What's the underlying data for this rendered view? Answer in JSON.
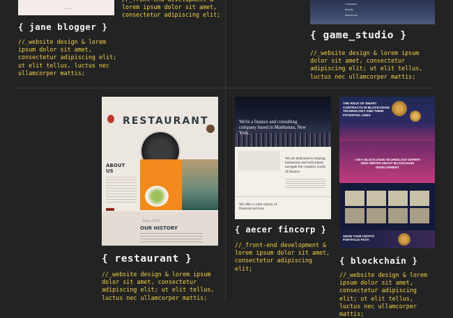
{
  "projects": [
    {
      "title": "{ jane blogger }",
      "desc": "//_website design & lorem ipsum dolor sit amet, consectetur adipiscing elit; ut elit tellus, luctus nec ullamcorper mattis;"
    },
    {
      "title": "",
      "desc": "//_front-end development & lorem ipsum dolor sit amet, consectetur adipiscing elit;"
    },
    {
      "title": "{ game_studio }",
      "desc": "//_website design & lorem ipsum dolor sit amet, consectetur adipiscing elit; ut elit tellus, luctus nec ullamcorper mattis;"
    },
    {
      "title": "{ restaurant }",
      "desc": "//_website design & lorem ipsum dolor sit amet, consectetur adipiscing elit; ut elit tellus, luctus nec ullamcorper mattis;"
    },
    {
      "title": "{ aecer fincorp }",
      "desc": "//_front-end development & lorem ipsum dolor sit amet, consectetur adipiscing elit;"
    },
    {
      "title": "{ blockchain }",
      "desc": "//_website design & lorem ipsum dolor sit amet, consectetur adipiscing elit; ut elit tellus, luctus nec ullamcorper mattis;"
    }
  ],
  "thumbs": {
    "jane": {
      "line": "Sidebar"
    },
    "game": {
      "items": [
        "Company",
        "Mobile",
        "Adventure"
      ]
    },
    "restaurant": {
      "heading": "RESTAURANT",
      "about": "ABOUT US",
      "history": "OUR HISTORY",
      "since": "Since 1979"
    },
    "finance": {
      "hero": "We're a finance and consulting company based in Manhattan, New York.",
      "mid": "We are dedicated to helping businesses and individuals navigate the complex world of finance.",
      "bottom": "We offer a wide variety of financial services"
    },
    "blockchain": {
      "hero": "THE ROLE OF SMART CONTRACTS IN BLOCKCHAIN TECHNOLOGY AND THEIR POTENTIAL USES",
      "mid": "I AM A BLOCKCHAIN TECHNOLOGY EXPERT WHO WRITES ABOUT BLOCKCHAIN DEVELOPMENT",
      "cta": "GROW YOUR CRYPTO PORTFOLIO FAST!"
    }
  }
}
